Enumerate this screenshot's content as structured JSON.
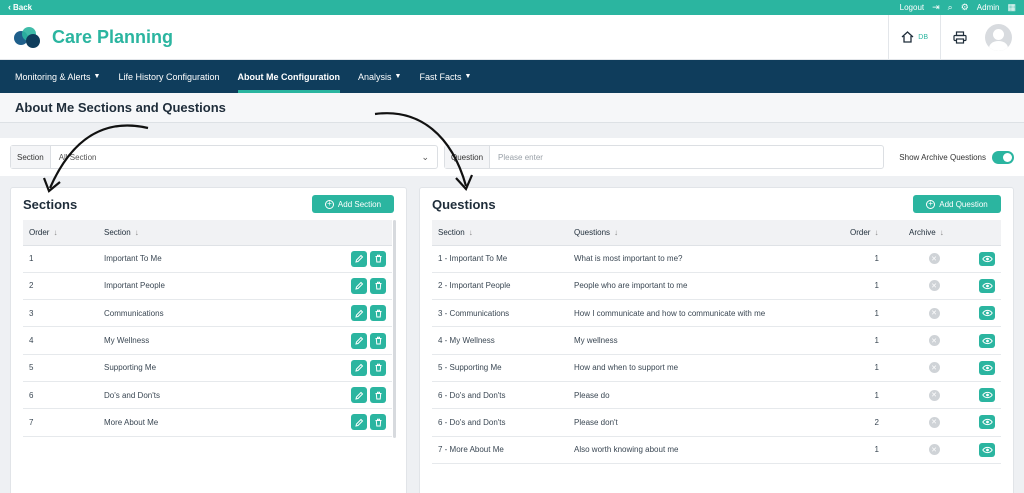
{
  "topbar": {
    "back_label": "Back",
    "logout_label": "Logout",
    "admin_label": "Admin"
  },
  "brand": {
    "name": "Care Planning",
    "colors": {
      "accent": "#2bb5a0",
      "nav": "#0f3d5c"
    }
  },
  "header": {
    "home_label": "DB"
  },
  "nav": {
    "items": [
      {
        "label": "Monitoring & Alerts",
        "has_caret": true
      },
      {
        "label": "Life History Configuration",
        "has_caret": false
      },
      {
        "label": "About Me Configuration",
        "has_caret": false,
        "active": true
      },
      {
        "label": "Analysis",
        "has_caret": true
      },
      {
        "label": "Fast Facts",
        "has_caret": true
      }
    ]
  },
  "page": {
    "title": "About Me Sections and Questions"
  },
  "filters": {
    "section_label": "Section",
    "section_value": "All Section",
    "question_label": "Question",
    "question_placeholder": "Please enter",
    "archive_toggle_label": "Show Archive Questions",
    "archive_toggle_on": true
  },
  "sections": {
    "title": "Sections",
    "add_button": "Add Section",
    "headers": [
      "Order",
      "Section"
    ],
    "rows": [
      {
        "order": "1",
        "section": "Important To Me"
      },
      {
        "order": "2",
        "section": "Important People"
      },
      {
        "order": "3",
        "section": "Communications"
      },
      {
        "order": "4",
        "section": "My Wellness"
      },
      {
        "order": "5",
        "section": "Supporting Me"
      },
      {
        "order": "6",
        "section": "Do's and Don'ts"
      },
      {
        "order": "7",
        "section": "More About Me"
      }
    ]
  },
  "questions": {
    "title": "Questions",
    "add_button": "Add Question",
    "headers": [
      "Section",
      "Questions",
      "Order",
      "Archive"
    ],
    "rows": [
      {
        "section": "1 - Important To Me",
        "question": "What is most important to me?",
        "order": "1"
      },
      {
        "section": "2 - Important People",
        "question": "People who are important to me",
        "order": "1"
      },
      {
        "section": "3 - Communications",
        "question": "How I communicate and how to communicate with me",
        "order": "1"
      },
      {
        "section": "4 - My Wellness",
        "question": "My wellness",
        "order": "1"
      },
      {
        "section": "5 - Supporting Me",
        "question": "How and when to support me",
        "order": "1"
      },
      {
        "section": "6 - Do's and Don'ts",
        "question": "Please do",
        "order": "1"
      },
      {
        "section": "6 - Do's and Don'ts",
        "question": "Please don't",
        "order": "2"
      },
      {
        "section": "7 - More About Me",
        "question": "Also worth knowing about me",
        "order": "1"
      }
    ]
  },
  "icons": {
    "edit": "pencil-icon",
    "delete": "trash-icon",
    "view": "eye-icon",
    "archive": "x-circle-icon"
  }
}
